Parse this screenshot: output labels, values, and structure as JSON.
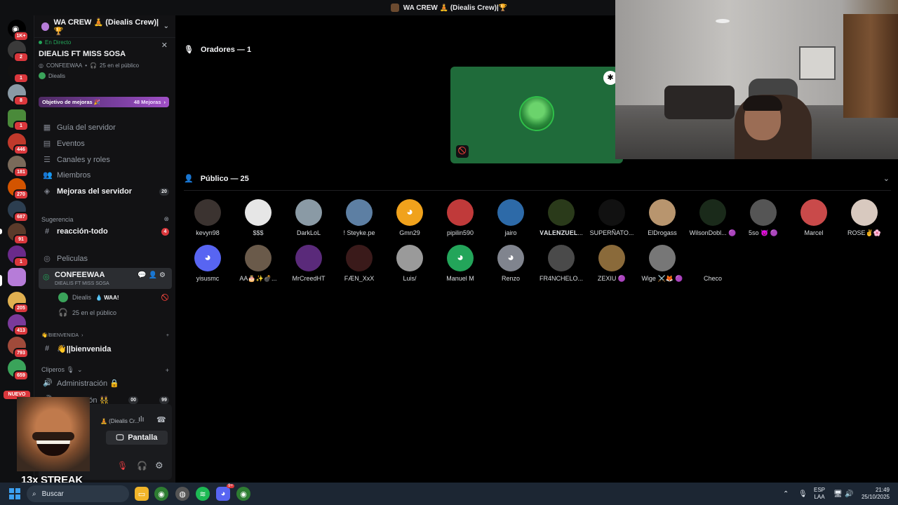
{
  "window_title": "WA CREW 🧘 (Diealis Crew)|🏆",
  "servers": {
    "badges": [
      "1K+",
      "2",
      "1",
      "8",
      "1",
      "446",
      "181",
      "270",
      "687",
      "91",
      "1",
      "",
      "205",
      "413",
      "793",
      "659"
    ],
    "nuevo_label": "NUEVO"
  },
  "guild": {
    "name": "WA CREW 🧘 (Diealis Crew)|🏆"
  },
  "stage": {
    "live_label": "En Directo",
    "title": "DIEALIS FT MISS SOSA",
    "channel": "CONFEEWAA",
    "audience": "25 en el público",
    "host": "Diealis"
  },
  "boost": {
    "label": "Objetivo de mejoras 🎉",
    "count": "48 Mejoras"
  },
  "nav": [
    {
      "label": "Guía del servidor"
    },
    {
      "label": "Eventos"
    },
    {
      "label": "Canales y roles"
    },
    {
      "label": "Miembros"
    },
    {
      "label": "Mejoras del servidor",
      "count": "20"
    }
  ],
  "suggestion": {
    "label": "Sugerencia",
    "channel": "reacción-todo",
    "count": "4"
  },
  "channels": {
    "peliculas": "Peliculas",
    "confeewaa": "CONFEEWAA",
    "confeewaa_sub": "DIEALIS FT MISS SOSA",
    "member_name": "Diealis",
    "member_tag": "💧 WAA!",
    "audience": "25 en el público",
    "cat_bienvenida": "👋/BIENVENIDA",
    "bienvenida": "👋||bienvenida",
    "cat_clipero": "Cliperos 🎙",
    "administracion": "Administración 🔒",
    "moderacion": "Moderación 👯",
    "mod_counts": [
      "00",
      "99"
    ]
  },
  "userpanel": {
    "channel": "🧘 (Diealis Cr...",
    "pantalla": "Pantalla"
  },
  "overlay": {
    "streak": "13x STREAK"
  },
  "main": {
    "speakers_label": "Oradores — 1",
    "audience_label": "Público — 25"
  },
  "audience": [
    {
      "name": "kevyn98",
      "color": "#3b3330"
    },
    {
      "name": "$$$",
      "color": "#e6e6e6"
    },
    {
      "name": "DarkLoL",
      "color": "#8a9aa5"
    },
    {
      "name": "! Steyke.pe",
      "color": "#5d7fa3"
    },
    {
      "name": "Gmn29",
      "color": "#f0a21c",
      "discord": true
    },
    {
      "name": "pipilin590",
      "color": "#c03a3a"
    },
    {
      "name": "jairo",
      "color": "#2d6aa8"
    },
    {
      "name": "𝐕𝐀𝐋𝐄𝐍𝐙𝐔𝐄𝐋...",
      "color": "#2a3a1a"
    },
    {
      "name": "SUPERÑATO...",
      "color": "#111"
    },
    {
      "name": "ElDrogass",
      "color": "#b8956e"
    },
    {
      "name": "WilsonDobl... 🟣",
      "color": "#1a2a1a"
    },
    {
      "name": "5so 👿 🟣",
      "color": "#555"
    },
    {
      "name": "Marcel",
      "color": "#c94a4a"
    },
    {
      "name": "ROSE✌️🌸",
      "color": "#d8c9bf"
    },
    {
      "name": "yisusmc",
      "color": "#5865f2",
      "discord": true
    },
    {
      "name": "AA🎂✨💣...",
      "color": "#6a5a4a"
    },
    {
      "name": "MrCreedHT",
      "color": "#5a2a7a"
    },
    {
      "name": "FÆN_XxX",
      "color": "#3a1a1a"
    },
    {
      "name": "Luis/",
      "color": "#9a9a9a"
    },
    {
      "name": "Manuel M",
      "color": "#23a55a",
      "discord": true
    },
    {
      "name": "Renzo",
      "color": "#80848e",
      "discord": true
    },
    {
      "name": "FR4NCHELO...",
      "color": "#4a4a4a"
    },
    {
      "name": "ZEXIU 🟣",
      "color": "#8a6a3a"
    },
    {
      "name": "Wige ⚔️🦊 🟣",
      "color": "#777"
    },
    {
      "name": "Checo",
      "color": "#000"
    }
  ],
  "taskbar": {
    "search_placeholder": "Buscar",
    "lang": "ESP",
    "lang2": "LAA",
    "time": "21:49",
    "date": "25/10/2025",
    "discord_badge": "9+"
  }
}
